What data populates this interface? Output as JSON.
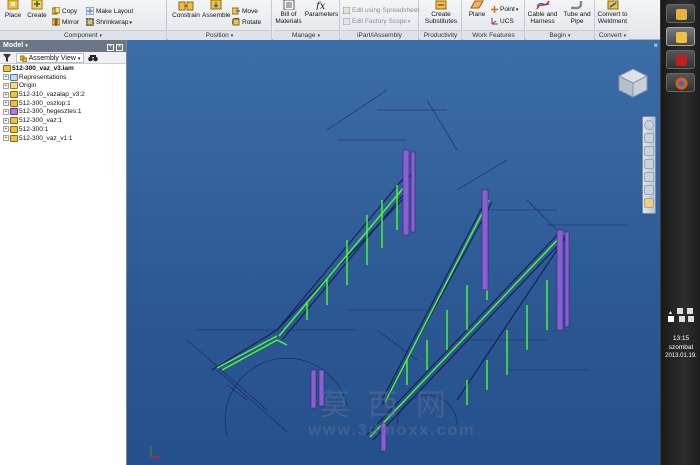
{
  "ribbon": {
    "panels": {
      "component": "Component",
      "position": "Position",
      "manage": "Manage",
      "ipart": "iPart/iAssembly",
      "productivity": "Productivity",
      "work_features": "Work Features",
      "begin": "Begin",
      "convert": "Convert"
    },
    "buttons": {
      "place": "Place",
      "create": "Create",
      "copy": "Copy",
      "mirror": "Mirror",
      "make_layout": "Make Layout",
      "shrinkwrap": "Shrinkwrap",
      "constrain": "Constrain",
      "assemble": "Assemble",
      "move": "Move",
      "rotate": "Rotate",
      "bill_of_materials": "Bill of Materials",
      "parameters": "Parameters",
      "edit_using_spreadsheet": "Edit using Spreadsheet",
      "edit_factory_scope": "Edit Factory Scope",
      "create_substitutes": "Create Substitutes",
      "plane": "Plane",
      "point": "Point",
      "ucs": "UCS",
      "cable_and_harness": "Cable and Harness",
      "tube_and_pipe": "Tube and Pipe",
      "convert_to_weldment": "Convert to Weldment"
    }
  },
  "browser": {
    "title": "Model",
    "view_mode": "Assembly View",
    "tree": [
      {
        "label": "512-300_vaz_v3.iam",
        "root": true
      },
      {
        "label": "Representations"
      },
      {
        "label": "Origin"
      },
      {
        "label": "512-310_vazalap_v3:2"
      },
      {
        "label": "512-300_oszlop:1"
      },
      {
        "label": "512-300_hegesztes:1"
      },
      {
        "label": "512-300_vaz:1"
      },
      {
        "label": "512-300:1"
      },
      {
        "label": "512-300_vaz_v1:1"
      }
    ]
  },
  "viewport": {
    "watermark_text": "莫西网",
    "watermark_url": "www.3dmoxx.com"
  },
  "taskbar": {
    "time": "13:15",
    "day": "szombat",
    "date": "2013.01.19."
  },
  "colors": {
    "viewport_bg": "#2c5994",
    "green_struts": "#4cff2a",
    "purple_bars": "#8a5fd1",
    "model_lines": "#1b1f5c"
  }
}
